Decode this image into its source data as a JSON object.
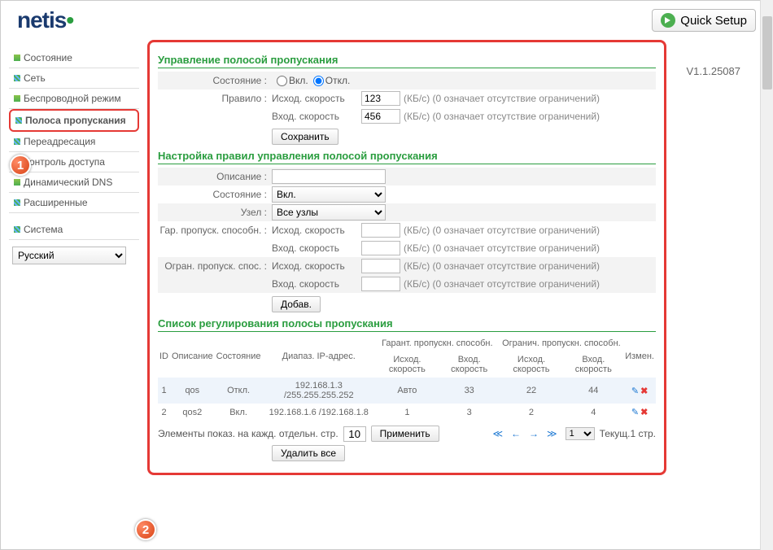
{
  "header": {
    "logo_text": "netis",
    "quick_setup": "Quick Setup",
    "version": "V1.1.25087"
  },
  "sidebar": {
    "items": [
      {
        "label": "Состояние",
        "bullet": "g"
      },
      {
        "label": "Сеть",
        "bullet": "m"
      },
      {
        "label": "Беспроводной режим",
        "bullet": "g"
      },
      {
        "label": "Полоса пропускания",
        "bullet": "m",
        "active": true
      },
      {
        "label": "Переадресация",
        "bullet": "m"
      },
      {
        "label": "Контроль доступа",
        "bullet": "m"
      },
      {
        "label": "Динамический DNS",
        "bullet": "g"
      },
      {
        "label": "Расширенные",
        "bullet": "m"
      },
      {
        "label": "Система",
        "bullet": "m"
      }
    ],
    "language": "Русский"
  },
  "section1": {
    "title": "Управление полосой пропускания",
    "state_label": "Состояние :",
    "state_on": "Вкл.",
    "state_off": "Откл.",
    "state_value": "off",
    "rule_label": "Правило :",
    "out_label": "Исход. скорость",
    "in_label": "Вход. скорость",
    "out_value": "123",
    "in_value": "456",
    "unit_hint": "(КБ/с) (0 означает отсутствие ограничений)",
    "save_btn": "Сохранить"
  },
  "section2": {
    "title": "Настройка правил управления полосой пропускания",
    "desc_label": "Описание :",
    "desc_value": "",
    "state_label": "Состояние :",
    "state_value": "Вкл.",
    "node_label": "Узел :",
    "node_value": "Все узлы",
    "guar_label": "Гар. пропуск. способн. :",
    "limit_label": "Огран. пропуск. спос. :",
    "out_label": "Исход. скорость",
    "in_label": "Вход. скорость",
    "unit_hint": "(КБ/с) (0 означает отсутствие ограничений)",
    "add_btn": "Добав."
  },
  "section3": {
    "title": "Список регулирования полосы пропускания",
    "cols": {
      "id": "ID",
      "desc": "Описание",
      "state": "Состояние",
      "ip": "Диапаз. IP-адрес.",
      "guar": "Гарант. пропускн. способн.",
      "limit": "Огранич. пропускн. способн.",
      "out": "Исход. скорость",
      "in": "Вход. скорость",
      "edit": "Измен."
    },
    "rows": [
      {
        "id": "1",
        "desc": "qos",
        "state": "Откл.",
        "ip": "192.168.1.3 /255.255.255.252",
        "g_out": "Авто",
        "g_in": "33",
        "l_out": "22",
        "l_in": "44"
      },
      {
        "id": "2",
        "desc": "qos2",
        "state": "Вкл.",
        "ip": "192.168.1.6 /192.168.1.8",
        "g_out": "1",
        "g_in": "3",
        "l_out": "2",
        "l_in": "4"
      }
    ],
    "pager": {
      "per_page_label": "Элементы показ. на кажд. отдельн. стр.",
      "per_page_value": "10",
      "apply": "Применить",
      "page_sel": "1",
      "current": "Текущ.1 стр.",
      "delete_all": "Удалить все"
    }
  }
}
